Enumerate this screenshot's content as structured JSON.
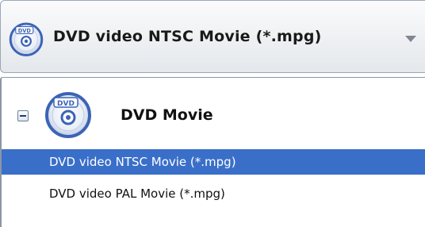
{
  "combo": {
    "selected_label": "DVD video NTSC Movie (*.mpg)",
    "icon": "dvd-disc-icon",
    "arrow_icon": "dropdown-arrow-icon"
  },
  "dropdown": {
    "group": {
      "title": "DVD Movie",
      "icon": "dvd-disc-icon",
      "toggle_icon": "collapse-minus-icon"
    },
    "items": [
      {
        "label": "DVD video NTSC Movie (*.mpg)",
        "selected": true
      },
      {
        "label": "DVD video PAL Movie (*.mpg)",
        "selected": false
      }
    ]
  },
  "colors": {
    "selection": "#3a6fc9",
    "disc_blue": "#3b64b5",
    "border": "#9aa6b8"
  }
}
